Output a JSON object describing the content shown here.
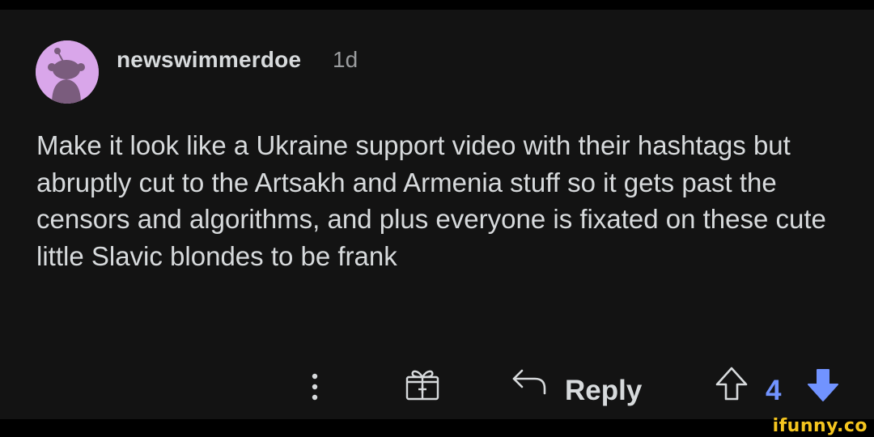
{
  "comment": {
    "username": "newswimmerdoe",
    "age": "1d",
    "body": "Make it look like a Ukraine support video with their hashtags but abruptly cut to the Artsakh and Armenia stuff so it gets past the censors and algorithms, and plus everyone is fixated on these cute little Slavic blondes to be frank"
  },
  "actions": {
    "more_icon": "more-vertical-icon",
    "award_icon": "gift-icon",
    "reply_icon": "reply-arrow-icon",
    "reply_label": "Reply",
    "score": "4",
    "upvote_icon": "upvote-outline-icon",
    "downvote_icon": "downvote-filled-icon"
  },
  "watermark": "ifunny.co",
  "colors": {
    "background": "#131313",
    "text": "#d7dadc",
    "vote_accent": "#7193ff",
    "avatar_bg": "#d9a6ea",
    "watermark": "#f4c51f"
  }
}
